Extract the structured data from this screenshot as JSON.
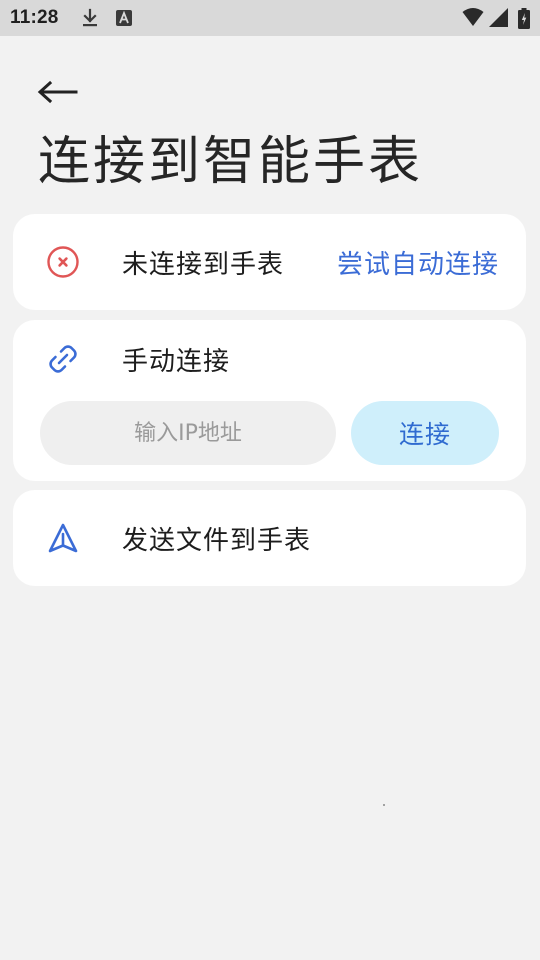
{
  "status_bar": {
    "time": "11:28",
    "icons": [
      "download-icon",
      "a-icon",
      "wifi-icon",
      "signal-icon",
      "battery-icon"
    ]
  },
  "header": {
    "back_icon": "arrow-left-icon",
    "title": "连接到智能手表"
  },
  "connection_status": {
    "icon": "error-circle-icon",
    "label": "未连接到手表",
    "action_label": "尝试自动连接"
  },
  "manual_connect": {
    "icon": "link-icon",
    "label": "手动连接",
    "input_value": "",
    "input_placeholder": "输入IP地址",
    "button_label": "连接"
  },
  "send_file": {
    "icon": "send-icon",
    "label": "发送文件到手表"
  },
  "colors": {
    "background": "#f2f2f2",
    "card": "#ffffff",
    "accent": "#3b6cd6",
    "button_bg": "#cfeffb",
    "error": "#e05656"
  }
}
